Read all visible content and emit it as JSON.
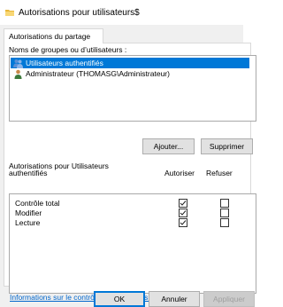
{
  "window": {
    "title": "Autorisations pour utilisateurs$",
    "icon": "folder-icon"
  },
  "tab": {
    "label": "Autorisations du partage"
  },
  "groups": {
    "label": "Noms de groupes ou d’utilisateurs :",
    "items": [
      {
        "label": "Utilisateurs authentifiés",
        "icon": "user-group-icon",
        "selected": true
      },
      {
        "label": "Administrateur (THOMASG\\Administrateur)",
        "icon": "user-icon",
        "selected": false
      }
    ],
    "add_label": "Ajouter...",
    "remove_label": "Supprimer"
  },
  "permissions": {
    "header_line1": "Autorisations pour Utilisateurs",
    "header_line2": "authentifiés",
    "allow_header": "Autoriser",
    "deny_header": "Refuser",
    "rows": [
      {
        "name": "Contrôle total",
        "allow": true,
        "deny": false
      },
      {
        "name": "Modifier",
        "allow": true,
        "deny": false
      },
      {
        "name": "Lecture",
        "allow": true,
        "deny": false
      }
    ]
  },
  "link": {
    "text": "Informations sur le contrôle d’accès et les autorisations",
    "color": "#0066cc"
  },
  "footer": {
    "ok_label": "OK",
    "cancel_label": "Annuler",
    "apply_label": "Appliquer"
  },
  "colors": {
    "selection": "#0078d7",
    "dialog_bg": "#f0f0f0"
  }
}
